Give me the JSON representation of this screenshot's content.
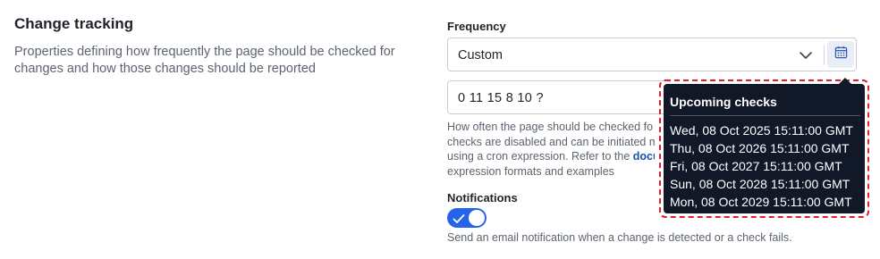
{
  "section": {
    "title": "Change tracking",
    "description": "Properties defining how frequently the page should be checked for changes and how those changes should be reported"
  },
  "frequency": {
    "label": "Frequency",
    "selected": "Custom",
    "chevron_icon": "chevron-down-icon",
    "calendar_icon": "calendar-icon"
  },
  "cron": {
    "value": "0 11 15 8 10 ?"
  },
  "help": {
    "line1": "How often the page should be checked fo",
    "line2": "checks are disabled and can be initiated m",
    "line3_prefix": "using a cron expression. Refer to the ",
    "line3_link": "docu",
    "line4": "expression formats and examples"
  },
  "notifications": {
    "label": "Notifications",
    "enabled": true,
    "caption": "Send an email notification when a change is detected or a check fails."
  },
  "tooltip": {
    "title": "Upcoming checks",
    "checks": [
      "Wed, 08 Oct 2025 15:11:00 GMT",
      "Thu, 08 Oct 2026 15:11:00 GMT",
      "Fri, 08 Oct 2027 15:11:00 GMT",
      "Sun, 08 Oct 2028 15:11:00 GMT",
      "Mon, 08 Oct 2029 15:11:00 GMT"
    ]
  },
  "colors": {
    "accent": "#2563eb",
    "tooltip_bg": "#111827",
    "highlight_border": "#e11d2e",
    "link": "#1d4fa8"
  }
}
